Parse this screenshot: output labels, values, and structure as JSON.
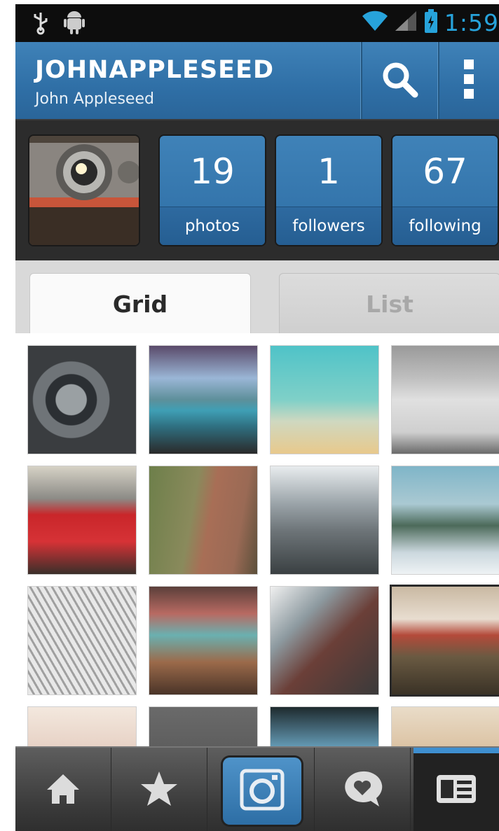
{
  "status_bar": {
    "time": "1:59",
    "icons": [
      "usb-icon",
      "android-icon",
      "wifi-icon",
      "signal-icon",
      "battery-icon"
    ]
  },
  "action_bar": {
    "username": "JOHNAPPLESEED",
    "full_name": "John Appleseed",
    "icons": [
      "search-icon",
      "overflow-menu-icon"
    ]
  },
  "profile": {
    "stats": [
      {
        "value": "19",
        "label": "photos"
      },
      {
        "value": "1",
        "label": "followers"
      },
      {
        "value": "67",
        "label": "following"
      }
    ]
  },
  "tabs": [
    {
      "label": "Grid",
      "selected": true
    },
    {
      "label": "List",
      "selected": false
    }
  ],
  "bottom_nav": {
    "icons": [
      "home-icon",
      "star-icon",
      "camera-icon",
      "speech-heart-icon",
      "profile-card-icon"
    ],
    "selected": "profile-card-icon"
  },
  "colors": {
    "accent_blue": "#2f6fa6",
    "status_blue": "#27a3db",
    "dark_bg": "#2c2c2c"
  }
}
